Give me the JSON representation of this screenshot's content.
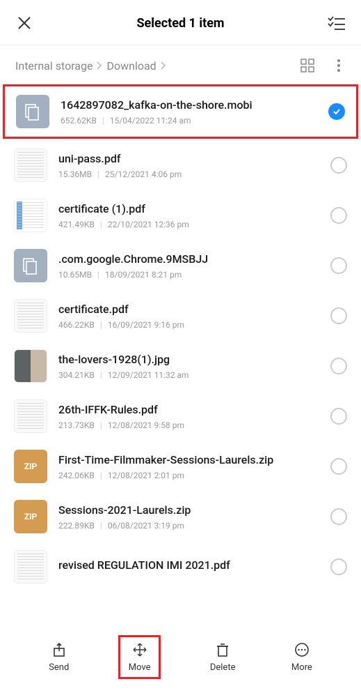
{
  "header": {
    "title": "Selected 1 item"
  },
  "breadcrumb": {
    "root": "Internal storage",
    "path": "Download"
  },
  "files": [
    {
      "name": "1642897082_kafka-on-the-shore.mobi",
      "size": "652.62KB",
      "date": "15/04/2022 11:24 am",
      "selected": true,
      "thumb": "doc"
    },
    {
      "name": "uni-pass.pdf",
      "size": "15.36MB",
      "date": "25/12/2021 4:06 pm",
      "selected": false,
      "thumb": "preview"
    },
    {
      "name": "certificate (1).pdf",
      "size": "421.49KB",
      "date": "22/10/2021 12:36 pm",
      "selected": false,
      "thumb": "card"
    },
    {
      "name": ".com.google.Chrome.9MSBJJ",
      "size": "10.65MB",
      "date": "18/09/2021 8:21 pm",
      "selected": false,
      "thumb": "doc"
    },
    {
      "name": "certificate.pdf",
      "size": "466.22KB",
      "date": "16/09/2021 9:16 pm",
      "selected": false,
      "thumb": "preview"
    },
    {
      "name": "the-lovers-1928(1).jpg",
      "size": "304.21KB",
      "date": "12/09/2021 11:32 am",
      "selected": false,
      "thumb": "photo"
    },
    {
      "name": "26th-IFFK-Rules.pdf",
      "size": "213.73KB",
      "date": "12/08/2021 9:58 pm",
      "selected": false,
      "thumb": "preview"
    },
    {
      "name": "First-Time-Filmmaker-Sessions-Laurels.zip",
      "size": "242.06KB",
      "date": "12/08/2021 2:01 pm",
      "selected": false,
      "thumb": "zip"
    },
    {
      "name": "Sessions-2021-Laurels.zip",
      "size": "222.89KB",
      "date": "06/08/2021 3:19 pm",
      "selected": false,
      "thumb": "zip"
    },
    {
      "name": "revised REGULATION IMI 2021.pdf",
      "size": "",
      "date": "",
      "selected": false,
      "thumb": "preview"
    }
  ],
  "zip_badge": "ZIP",
  "actions": {
    "send": "Send",
    "move": "Move",
    "delete": "Delete",
    "more": "More"
  }
}
